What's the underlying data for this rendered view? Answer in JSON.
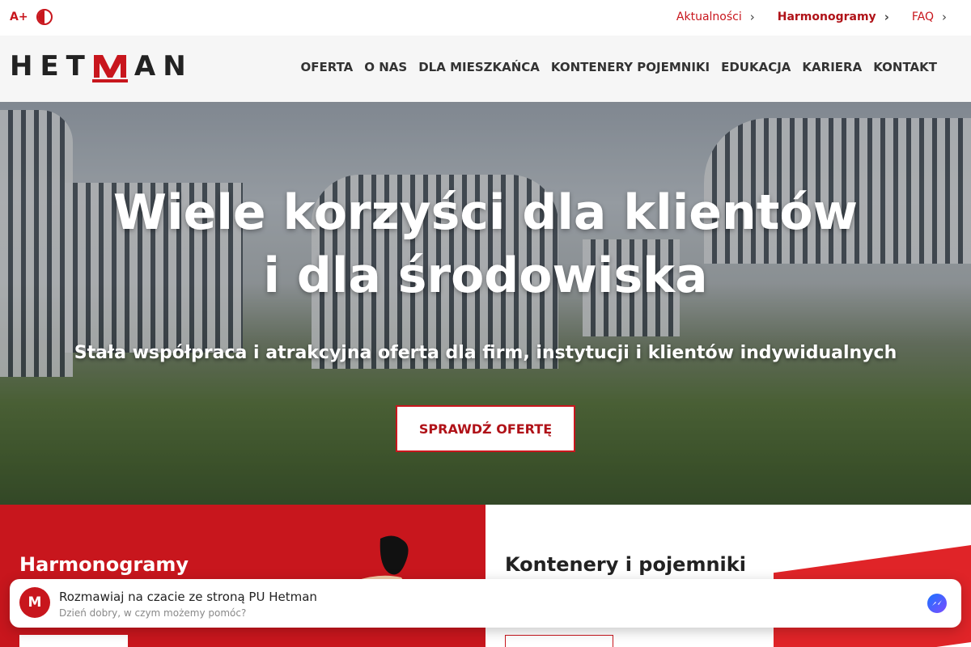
{
  "topbar": {
    "font_increase_label": "A+",
    "contrast_icon": "contrast-icon",
    "links": [
      {
        "label": "Aktualności"
      },
      {
        "label": "Harmonogramy"
      },
      {
        "label": "FAQ"
      }
    ],
    "chevron": "›"
  },
  "header": {
    "logo_text_left": "HET",
    "logo_text_right": "AN",
    "nav": [
      "OFERTA",
      "O NAS",
      "DLA MIESZKAŃCA",
      "KONTENERY POJEMNIKI",
      "EDUKACJA",
      "KARIERA",
      "KONTAKT"
    ]
  },
  "hero": {
    "title_line1": "Wiele korzyści dla klientów",
    "title_line2": "i dla środowiska",
    "subtitle": "Stała współpraca i atrakcyjna oferta dla firm, instytucji i klientów indywidualnych",
    "cta": "SPRAWDŹ OFERTĘ"
  },
  "tiles": [
    {
      "title": "Harmonogramy"
    },
    {
      "title": "Kontenery i pojemniki"
    }
  ],
  "chat": {
    "avatar": "M",
    "title": "Rozmawiaj na czacie ze stroną PU Hetman",
    "subtitle": "Dzień dobry, w czym możemy pomóc?",
    "icon": "messenger-icon"
  },
  "colors": {
    "brand_red": "#c8161d",
    "text_dark": "#222222"
  }
}
